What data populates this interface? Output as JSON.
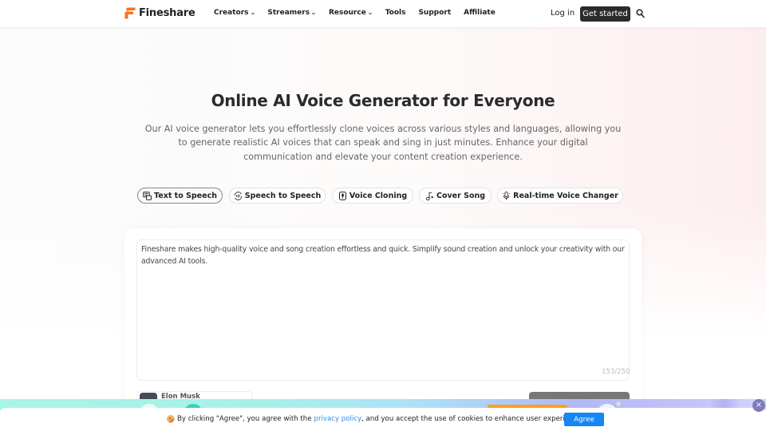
{
  "header": {
    "brand": "Fineshare",
    "nav": [
      {
        "label": "Creators",
        "has_dropdown": true
      },
      {
        "label": "Streamers",
        "has_dropdown": true
      },
      {
        "label": "Resource",
        "has_dropdown": true
      },
      {
        "label": "Tools",
        "has_dropdown": false
      },
      {
        "label": "Support",
        "has_dropdown": false
      },
      {
        "label": "Affiliate",
        "has_dropdown": false
      }
    ],
    "chevron": "⌄",
    "login_label": "Log in",
    "cta_label": "Get started",
    "search_icon": "search-icon"
  },
  "hero": {
    "title": "Online AI Voice Generator for Everyone",
    "subtitle": "Our AI voice generator lets you effortlessly clone voices across various styles and languages, allowing you to generate realistic AI voices that can speak and sing in just minutes. Enhance your digital communication and elevate your content creation experience."
  },
  "tabs": [
    {
      "label": "Text to Speech",
      "icon": "text-speech-icon",
      "active": true
    },
    {
      "label": "Speech to Speech",
      "icon": "speech-convert-icon",
      "active": false
    },
    {
      "label": "Voice Cloning",
      "icon": "voice-clone-icon",
      "active": false
    },
    {
      "label": "Cover Song",
      "icon": "music-note-icon",
      "active": false
    },
    {
      "label": "Real-time Voice Changer",
      "icon": "microphone-icon",
      "active": false
    }
  ],
  "editor": {
    "text": "Fineshare makes high-quality voice and song creation effortless and quick. Simplify sound creation and unlock your creativity with our advanced AI tools.",
    "counter": "153/250",
    "voice_name": "Elon Musk"
  },
  "cookie": {
    "text_before": "By clicking \"Agree\", you agree with the",
    "link_text": "privacy policy",
    "text_after": ", and you accept the use of cookies to enhance user experience.",
    "agree_label": "Agree"
  },
  "promo": {
    "close_label": "×"
  },
  "colors": {
    "brand_orange": "#f6751f",
    "cta_dark": "#2b2b2b",
    "link_blue": "#2a8cf2",
    "agree_blue": "#1586f3"
  }
}
